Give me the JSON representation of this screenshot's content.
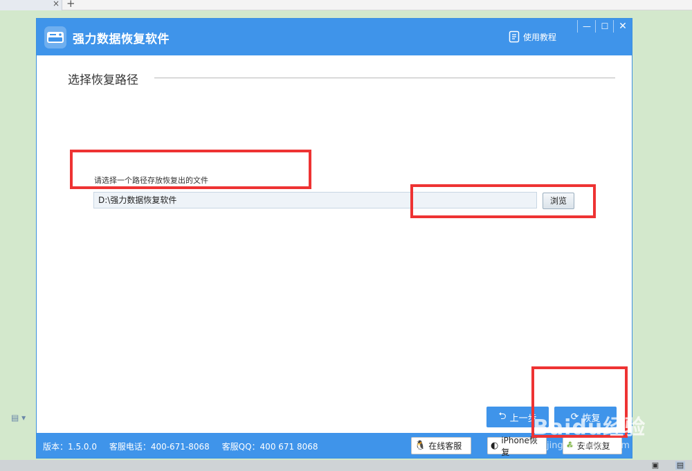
{
  "host": {
    "tab_close": "×",
    "tab_new": "+"
  },
  "app": {
    "title": "强力数据恢复软件",
    "tutorial_label": "使用教程",
    "win_min": "—",
    "win_max": "☐",
    "win_close": "✕"
  },
  "main": {
    "section_title": "选择恢复路径",
    "path_label": "请选择一个路径存放恢复出的文件",
    "path_value": "D:\\强力数据恢复软件",
    "browse_label": "浏览",
    "prev_label": "上一步",
    "recover_label": "恢复"
  },
  "footer": {
    "version": "版本：1.5.0.0",
    "phone": "客服电话：400-671-8068",
    "qq": "客服QQ：400 671 8068",
    "online_label": "在线客服",
    "iphone_label": "iPhone恢复",
    "android_label": "安卓恢复"
  },
  "watermark": {
    "text": "Baidu经验",
    "sub": "jingyan.baidu.com"
  },
  "colors": {
    "accent": "#3f94ea",
    "annotation": "#ee3333",
    "background": "#d3e8cc"
  }
}
